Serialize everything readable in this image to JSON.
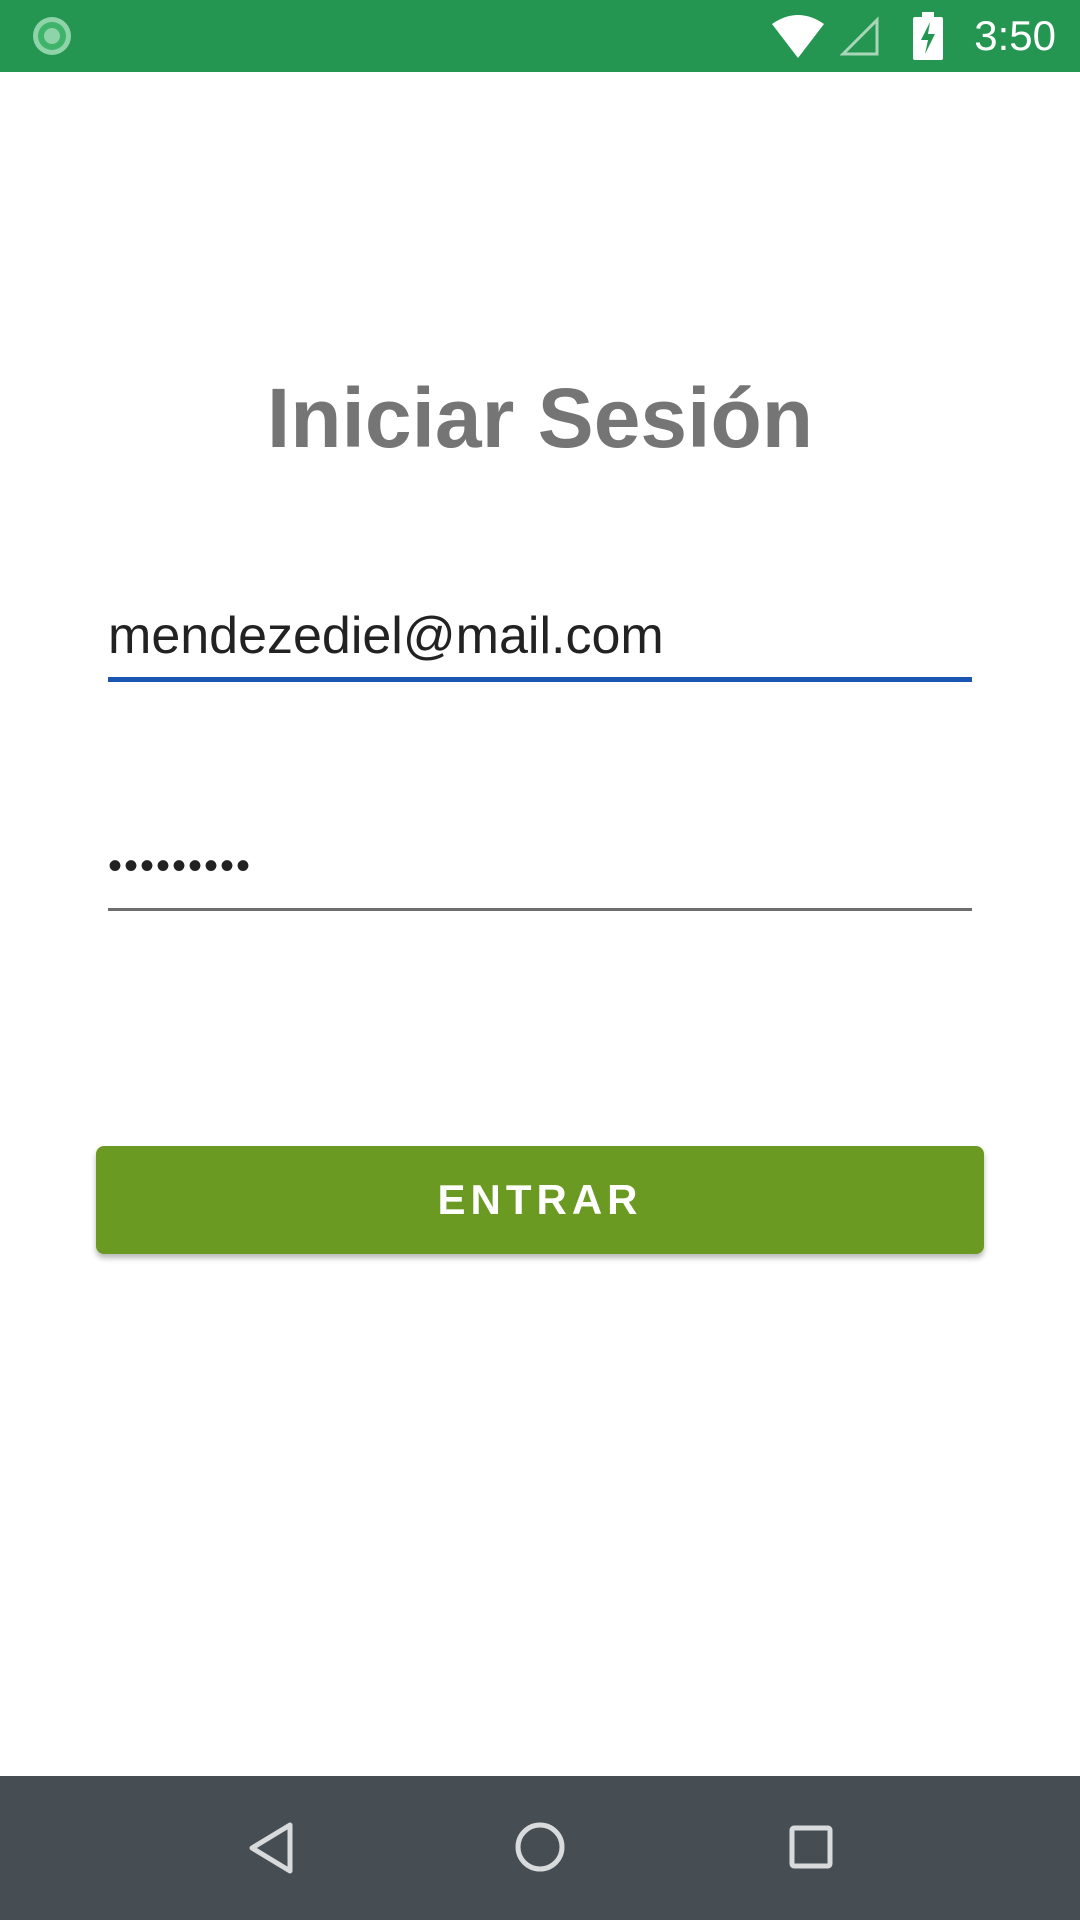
{
  "status_bar": {
    "time": "3:50",
    "icons": [
      "app-notification-icon",
      "wifi-icon",
      "cell-signal-icon",
      "battery-charging-icon"
    ],
    "background_color": "#249651"
  },
  "login": {
    "title": "Iniciar Sesión",
    "email_value": "mendezediel@mail.com",
    "password_value": "•••••••••",
    "submit_label": "ENTRAR"
  },
  "colors": {
    "accent_underline": "#1a55b2",
    "button": "#6b9a22",
    "title": "#757575",
    "nav_bar": "#464d53"
  },
  "nav_bar": {
    "icons": [
      "back-icon",
      "home-icon",
      "recents-icon"
    ]
  }
}
